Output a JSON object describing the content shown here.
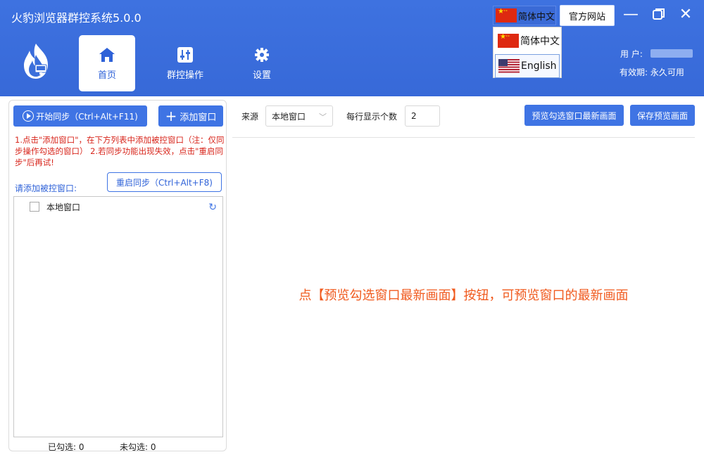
{
  "app": {
    "title": "火豹浏览器群控系统5.0.0"
  },
  "nav": {
    "tabs": [
      {
        "label": "首页",
        "icon": "home-icon",
        "active": true
      },
      {
        "label": "群控操作",
        "icon": "sliders-icon",
        "active": false
      },
      {
        "label": "设置",
        "icon": "gear-icon",
        "active": false
      }
    ]
  },
  "header": {
    "lang_current": "简体中文",
    "official_site": "官方网站",
    "user_label": "用  户:",
    "valid_label": "有效期: 永久可用"
  },
  "lang_menu": {
    "options": [
      {
        "label": "简体中文",
        "flag": "flag-cn"
      },
      {
        "label": "English",
        "flag": "flag-us"
      }
    ]
  },
  "left_panel": {
    "start_sync": "开始同步（Ctrl+Alt+F11)",
    "add_window": "添加窗口",
    "hint": "1.点击\"添加窗口\"，在下方列表中添加被控窗口（注：仅同步操作勾选的窗口） 2.若同步功能出现失效，点击\"重启同步\"后再试!",
    "add_label": "请添加被控窗口:",
    "restart_sync": "重启同步（Ctrl+Alt+F8)",
    "list": [
      {
        "label": "本地窗口",
        "checked": false
      }
    ],
    "checked_count": "已勾选:  0",
    "unchecked_count": "未勾选:  0"
  },
  "toolbar": {
    "source_label": "来源",
    "source_value": "本地窗口",
    "per_row_label": "每行显示个数",
    "per_row_value": "2",
    "preview_button": "预览勾选窗口最新画面",
    "save_button": "保存预览画面"
  },
  "preview": {
    "message": "点【预览勾选窗口最新画面】按钮，可预览窗口的最新画面"
  },
  "colors": {
    "brand": "#3b6fdb",
    "accent": "#3f74e4",
    "hint": "#d8261c",
    "message": "#f05a1e"
  }
}
